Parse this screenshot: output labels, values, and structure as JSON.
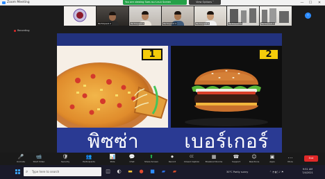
{
  "window": {
    "title": "Zoom Meeting",
    "sharing_banner": "You are viewing Sam-ra-ri-ra-k Screen",
    "view_options": "View Options ˅",
    "controls": [
      "—",
      "☐",
      "✕"
    ]
  },
  "participants": [
    {
      "name": "",
      "kind": "logo"
    },
    {
      "name": "Participant 2",
      "kind": "person"
    },
    {
      "name": "Participant 3",
      "kind": "person"
    },
    {
      "name": "Participant 4",
      "kind": "person"
    },
    {
      "name": "Participant 5",
      "kind": "person"
    },
    {
      "name": "Participant 6",
      "kind": "scene"
    },
    {
      "name": "Participant 7",
      "kind": "scene"
    }
  ],
  "nav_arrow": "›",
  "recording": {
    "label": "Recording"
  },
  "slide": {
    "panels": [
      {
        "number": "1",
        "caption": "พิซซ่า"
      },
      {
        "number": "2",
        "caption": "เบอร์เกอร์"
      }
    ]
  },
  "toolbar": {
    "items": [
      {
        "label": "Unmute",
        "icon": "🎤"
      },
      {
        "label": "Start Video",
        "icon": "📹"
      },
      {
        "label": "Security",
        "icon": "🛡"
      },
      {
        "label": "Participants",
        "icon": "👥"
      },
      {
        "label": "Polls",
        "icon": "📊"
      },
      {
        "label": "Chat",
        "icon": "💬"
      },
      {
        "label": "Share Screen",
        "icon": "⬆"
      },
      {
        "label": "Record",
        "icon": "⏺"
      },
      {
        "label": "Closed Caption",
        "icon": "CC"
      },
      {
        "label": "Breakout Rooms",
        "icon": "▦"
      },
      {
        "label": "Support",
        "icon": "☎"
      },
      {
        "label": "Reactions",
        "icon": "☺"
      },
      {
        "label": "Apps",
        "icon": "▣"
      },
      {
        "label": "More",
        "icon": "…"
      }
    ],
    "end_label": "End"
  },
  "taskbar": {
    "search_placeholder": "Type here to search",
    "weather": "30°C  Partly sunny",
    "time": "9:51 AM",
    "date": "7/4/2021"
  },
  "colors": {
    "accent": "#2d8cff",
    "share_green": "#24a148",
    "slide_blue": "#2a3a93",
    "badge_yellow": "#f5cc0a",
    "end_red": "#e02828"
  }
}
